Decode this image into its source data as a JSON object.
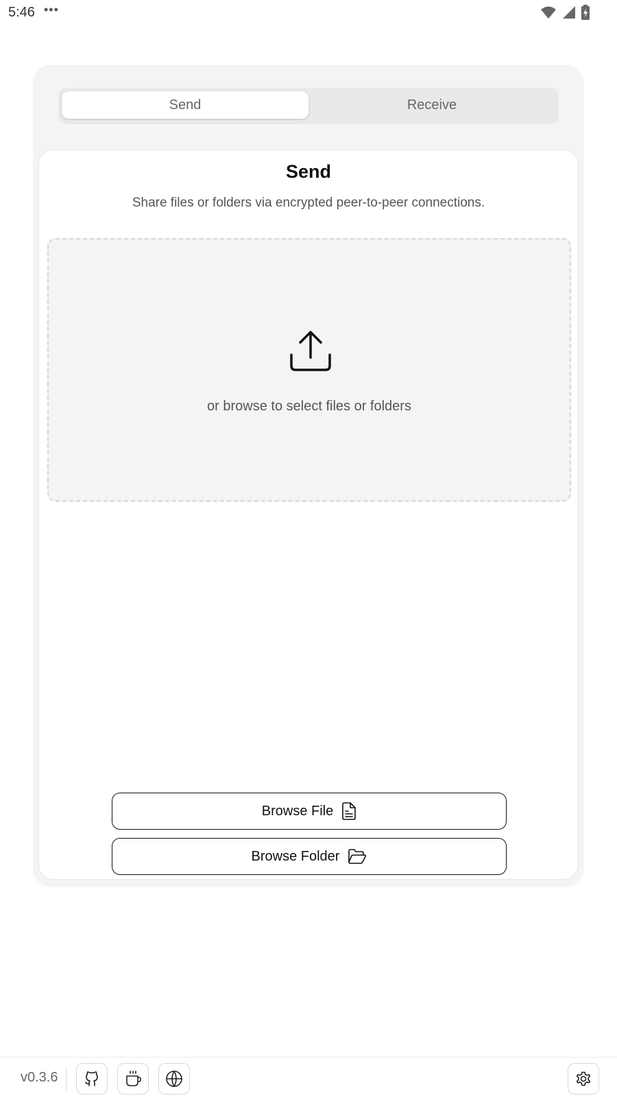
{
  "status_bar": {
    "time": "5:46",
    "dots": "•••"
  },
  "tabs": [
    {
      "label": "Send",
      "active": true
    },
    {
      "label": "Receive",
      "active": false
    }
  ],
  "panel": {
    "title": "Send",
    "subtitle": "Share files or folders via encrypted peer-to-peer connections."
  },
  "dropzone": {
    "hint": "or browse to select files or folders",
    "icon": "upload-icon"
  },
  "buttons": {
    "browse_file": {
      "label": "Browse File",
      "icon": "file-icon"
    },
    "browse_folder": {
      "label": "Browse Folder",
      "icon": "folder-open-icon"
    }
  },
  "footer": {
    "version": "v0.3.6",
    "icons": [
      "github-icon",
      "coffee-icon",
      "globe-icon",
      "gear-icon"
    ]
  },
  "colors": {
    "background": "#ffffff",
    "shell": "#f4f4f4",
    "tab_track": "#e9e9e9",
    "text_primary": "#111111",
    "text_secondary": "#555555"
  }
}
